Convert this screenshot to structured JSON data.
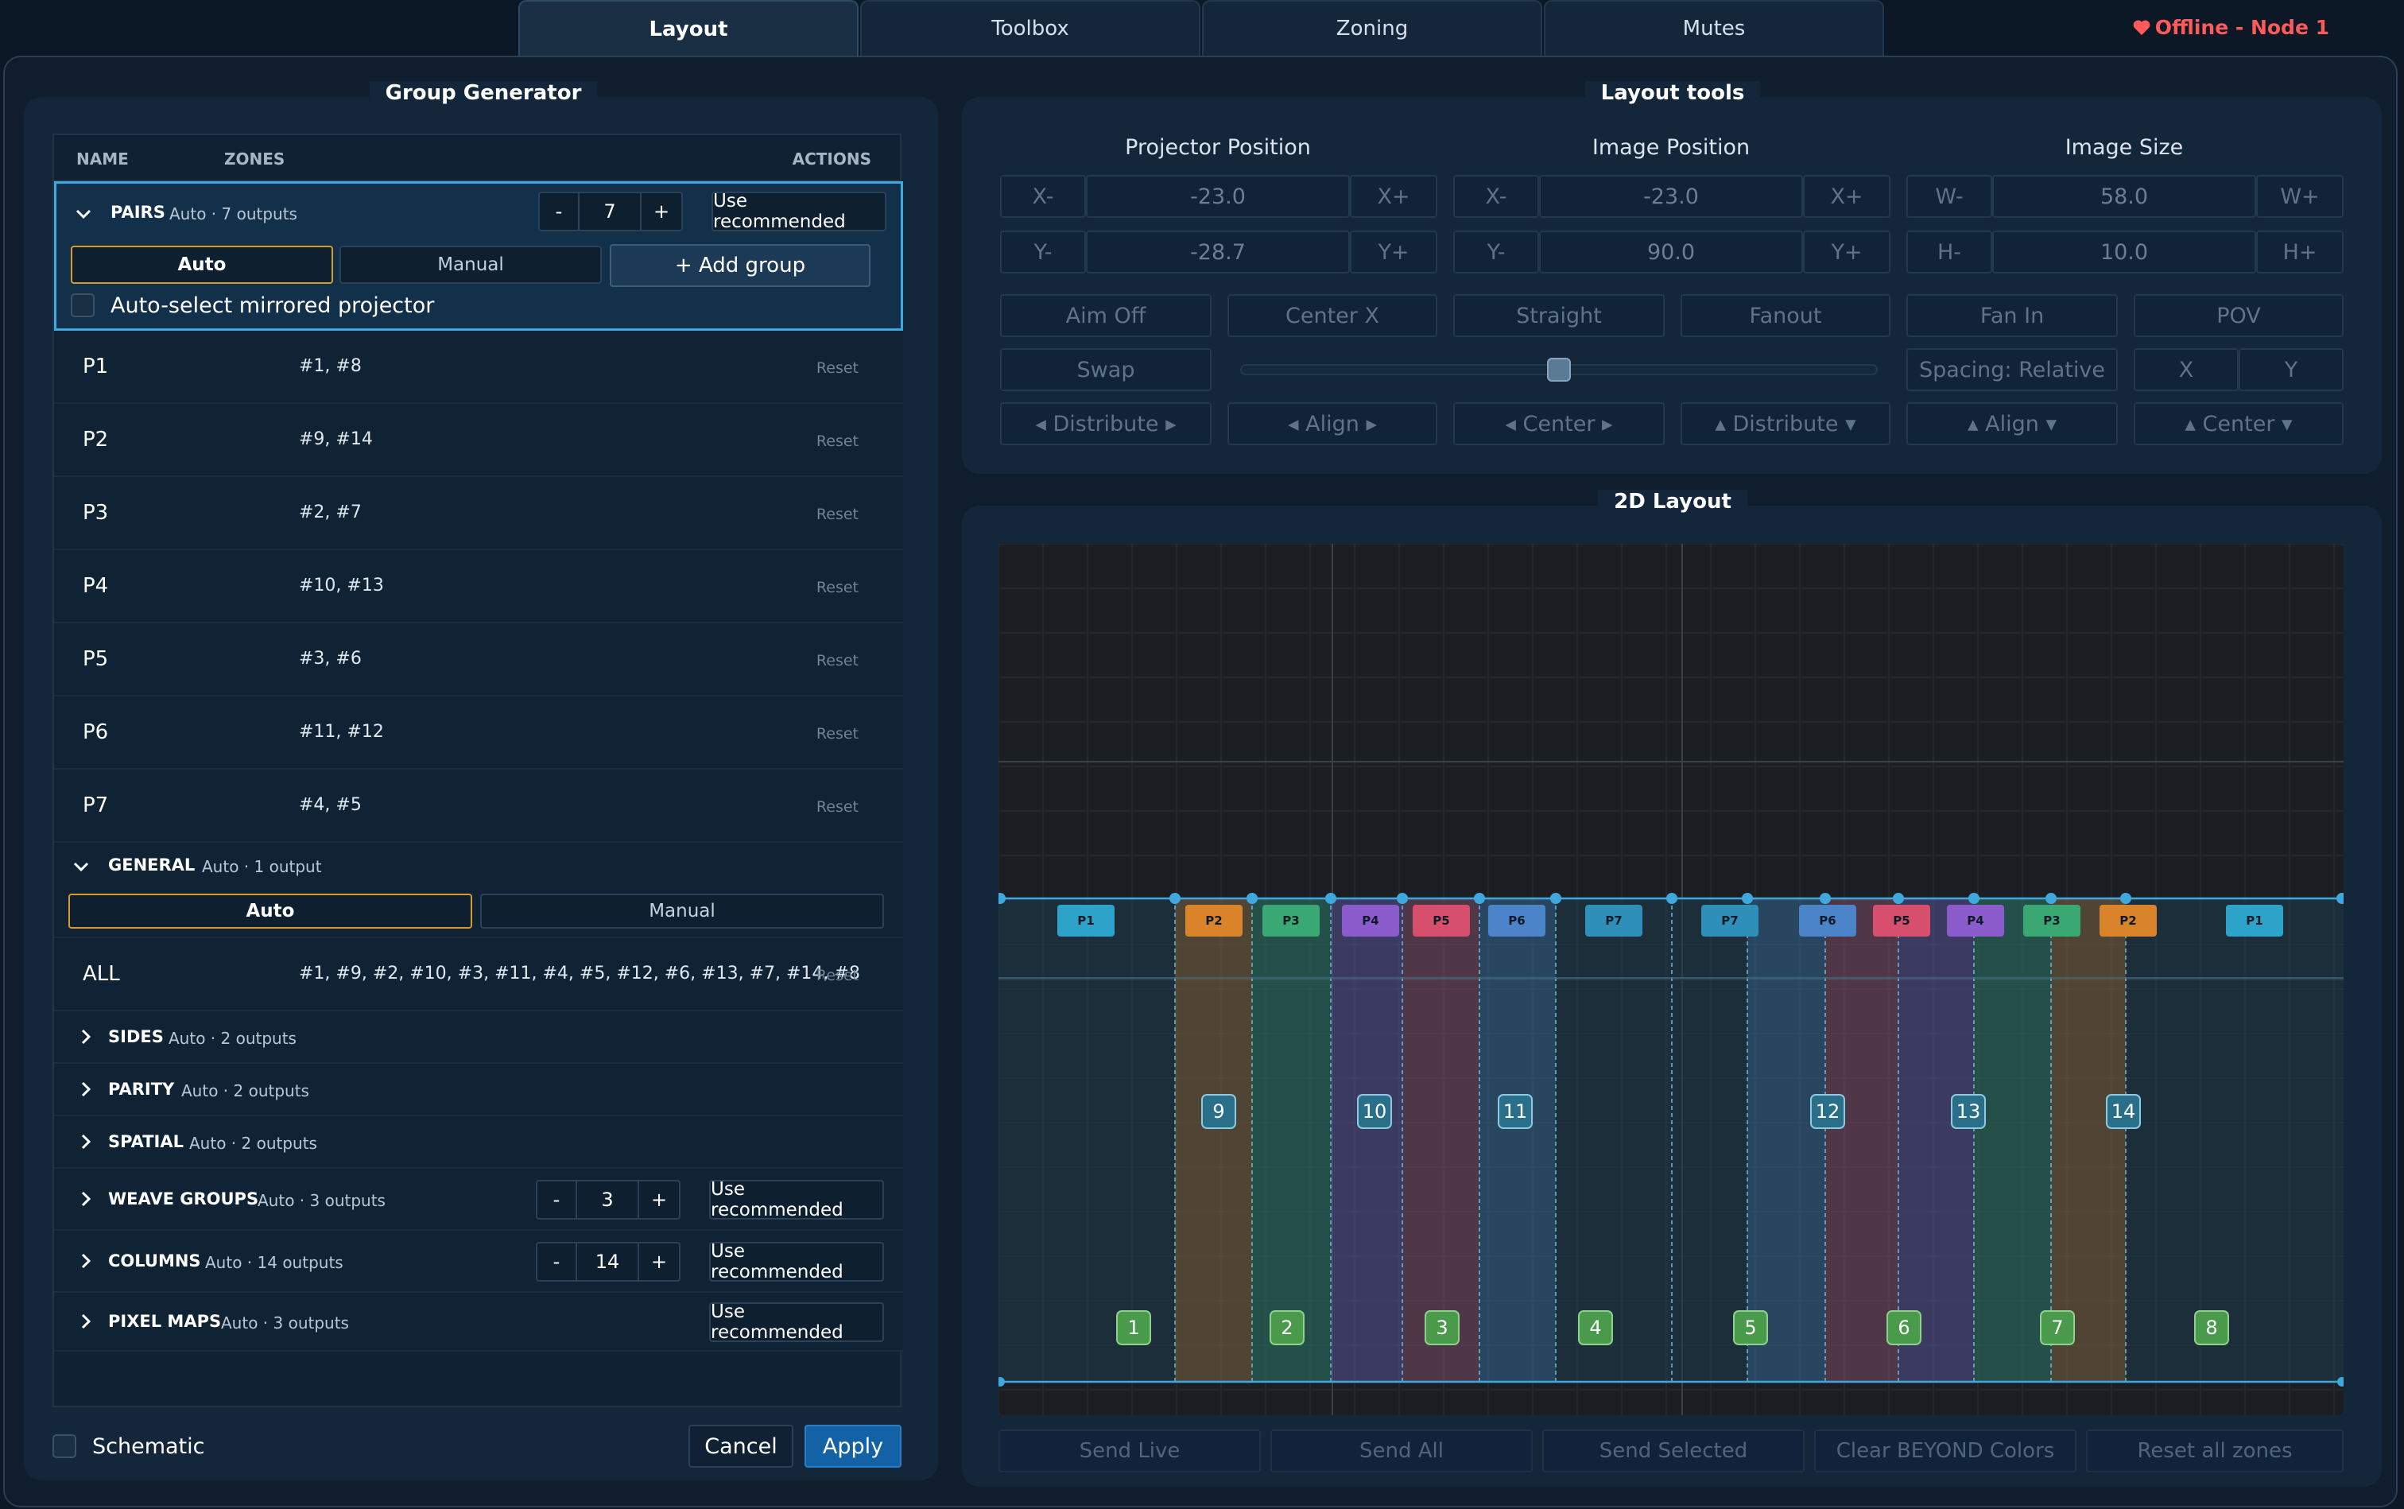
{
  "tabs": [
    {
      "label": "Layout",
      "active": true
    },
    {
      "label": "Toolbox",
      "active": false
    },
    {
      "label": "Zoning",
      "active": false
    },
    {
      "label": "Mutes",
      "active": false
    }
  ],
  "status": {
    "text": "Offline - Node 1",
    "color": "#ff5a5a",
    "icon": "heart-icon"
  },
  "group_generator": {
    "title": "Group Generator",
    "columns": {
      "name": "NAME",
      "zones": "ZONES",
      "actions": "ACTIONS"
    },
    "pairs": {
      "name": "PAIRS",
      "meta": "Auto · 7 outputs",
      "stepper_minus": "-",
      "stepper_value": "7",
      "stepper_plus": "+",
      "use_recommended": "Use recommended",
      "seg_auto": "Auto",
      "seg_manual": "Manual",
      "add_group": "+ Add group",
      "auto_select_label": "Auto-select mirrored projector",
      "rows": [
        {
          "name": "P1",
          "zones": "#1, #8",
          "action": "Reset"
        },
        {
          "name": "P2",
          "zones": "#9, #14",
          "action": "Reset"
        },
        {
          "name": "P3",
          "zones": "#2, #7",
          "action": "Reset"
        },
        {
          "name": "P4",
          "zones": "#10, #13",
          "action": "Reset"
        },
        {
          "name": "P5",
          "zones": "#3, #6",
          "action": "Reset"
        },
        {
          "name": "P6",
          "zones": "#11, #12",
          "action": "Reset"
        },
        {
          "name": "P7",
          "zones": "#4, #5",
          "action": "Reset"
        }
      ]
    },
    "general": {
      "name": "GENERAL",
      "meta": "Auto · 1 output",
      "seg_auto": "Auto",
      "seg_manual": "Manual",
      "row": {
        "name": "ALL",
        "zones": "#1, #9, #2, #10, #3, #11, #4, #5, #12, #6, #13, #7, #14, #8",
        "action": "Reset"
      }
    },
    "sides": {
      "name": "SIDES",
      "meta": "Auto · 2 outputs"
    },
    "parity": {
      "name": "PARITY",
      "meta": "Auto · 2 outputs"
    },
    "spatial": {
      "name": "SPATIAL",
      "meta": "Auto · 2 outputs"
    },
    "weave": {
      "name": "WEAVE GROUPS",
      "meta": "Auto · 3 outputs",
      "stepper_minus": "-",
      "stepper_value": "3",
      "stepper_plus": "+",
      "use_recommended": "Use recommended"
    },
    "columns_sec": {
      "name": "COLUMNS",
      "meta": "Auto · 14 outputs",
      "stepper_minus": "-",
      "stepper_value": "14",
      "stepper_plus": "+",
      "use_recommended": "Use recommended"
    },
    "pixel_maps": {
      "name": "PIXEL MAPS",
      "meta": "Auto · 3 outputs",
      "use_recommended": "Use recommended"
    },
    "schematic_label": "Schematic",
    "cancel": "Cancel",
    "apply": "Apply"
  },
  "layout_tools": {
    "title": "Layout tools",
    "projector_position": {
      "heading": "Projector Position",
      "x_minus": "X-",
      "x_value": "-23.0",
      "x_plus": "X+",
      "y_minus": "Y-",
      "y_value": "-28.7",
      "y_plus": "Y+"
    },
    "image_position": {
      "heading": "Image Position",
      "x_minus": "X-",
      "x_value": "-23.0",
      "x_plus": "X+",
      "y_minus": "Y-",
      "y_value": "90.0",
      "y_plus": "Y+"
    },
    "image_size": {
      "heading": "Image Size",
      "w_minus": "W-",
      "w_value": "58.0",
      "w_plus": "W+",
      "h_minus": "H-",
      "h_value": "10.0",
      "h_plus": "H+"
    },
    "row1": [
      "Aim Off",
      "Center X",
      "Straight",
      "Fanout",
      "Fan In",
      "POV"
    ],
    "swap": "Swap",
    "slider_level": 0.5,
    "spacing": "Spacing: Relative",
    "x_label": "X",
    "y_label": "Y",
    "row3": [
      "◂ Distribute ▸",
      "◂ Align ▸",
      "◂ Center ▸",
      "▴ Distribute ▾",
      "▴ Align ▾",
      "▴ Center ▾"
    ]
  },
  "layout_2d": {
    "title": "2D Layout",
    "projectors": [
      "P1",
      "P2",
      "P3",
      "P4",
      "P5",
      "P6",
      "P7",
      "P7",
      "P6",
      "P5",
      "P4",
      "P3",
      "P2",
      "P1"
    ],
    "bottom_zones": [
      "1",
      "2",
      "3",
      "4",
      "5",
      "6",
      "7",
      "8"
    ],
    "mid_zones": [
      "9",
      "10",
      "11",
      "12",
      "13",
      "14"
    ],
    "colors": {
      "P1": "#2ea3c9",
      "P2": "#d9832a",
      "P3": "#3aa873",
      "P4": "#8c5ccc",
      "P5": "#d64f6c",
      "P6": "#4c84c9",
      "P7": "#2e8fb8"
    }
  },
  "footer_buttons": [
    "Send Live",
    "Send All",
    "Send Selected",
    "Clear BEYOND Colors",
    "Reset all zones"
  ]
}
